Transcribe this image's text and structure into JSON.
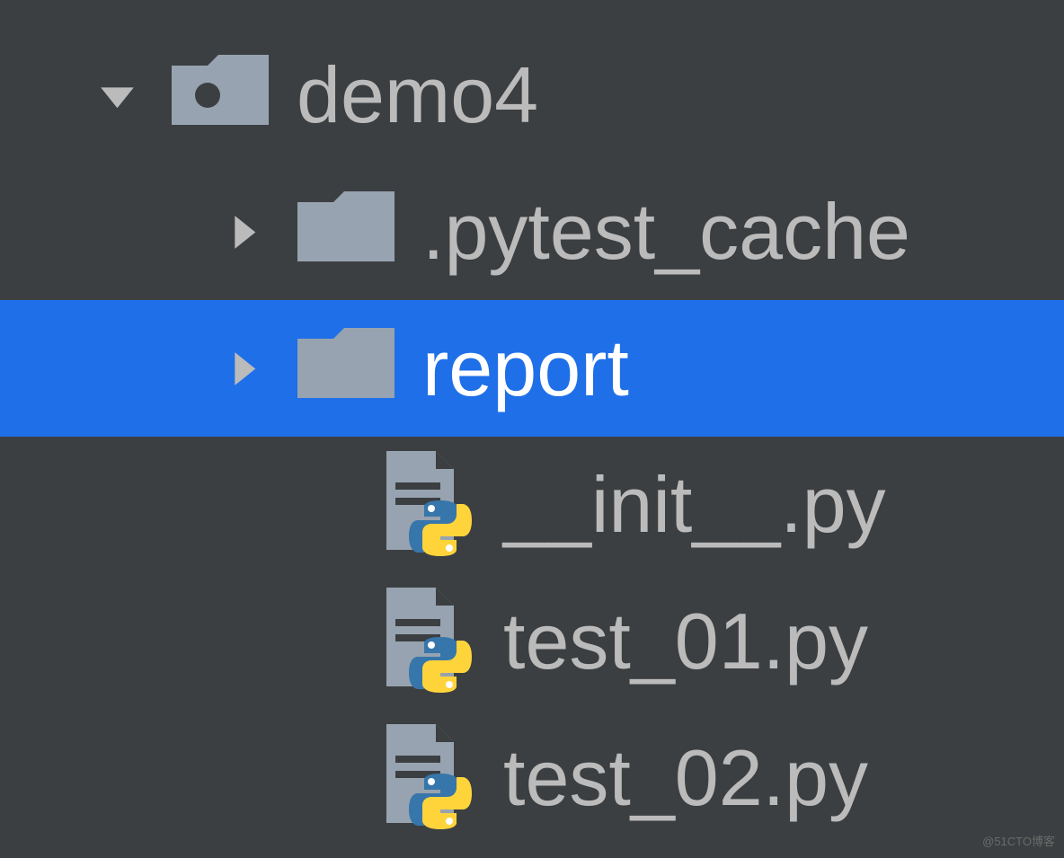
{
  "tree": {
    "root": {
      "name": "demo4",
      "expanded": true
    },
    "items": [
      {
        "name": ".pytest_cache",
        "type": "folder",
        "expanded": false,
        "selected": false
      },
      {
        "name": "report",
        "type": "folder",
        "expanded": false,
        "selected": true
      },
      {
        "name": "__init__.py",
        "type": "python-file",
        "selected": false
      },
      {
        "name": "test_01.py",
        "type": "python-file",
        "selected": false
      },
      {
        "name": "test_02.py",
        "type": "python-file",
        "selected": false
      }
    ]
  },
  "watermark": "@51CTO博客"
}
